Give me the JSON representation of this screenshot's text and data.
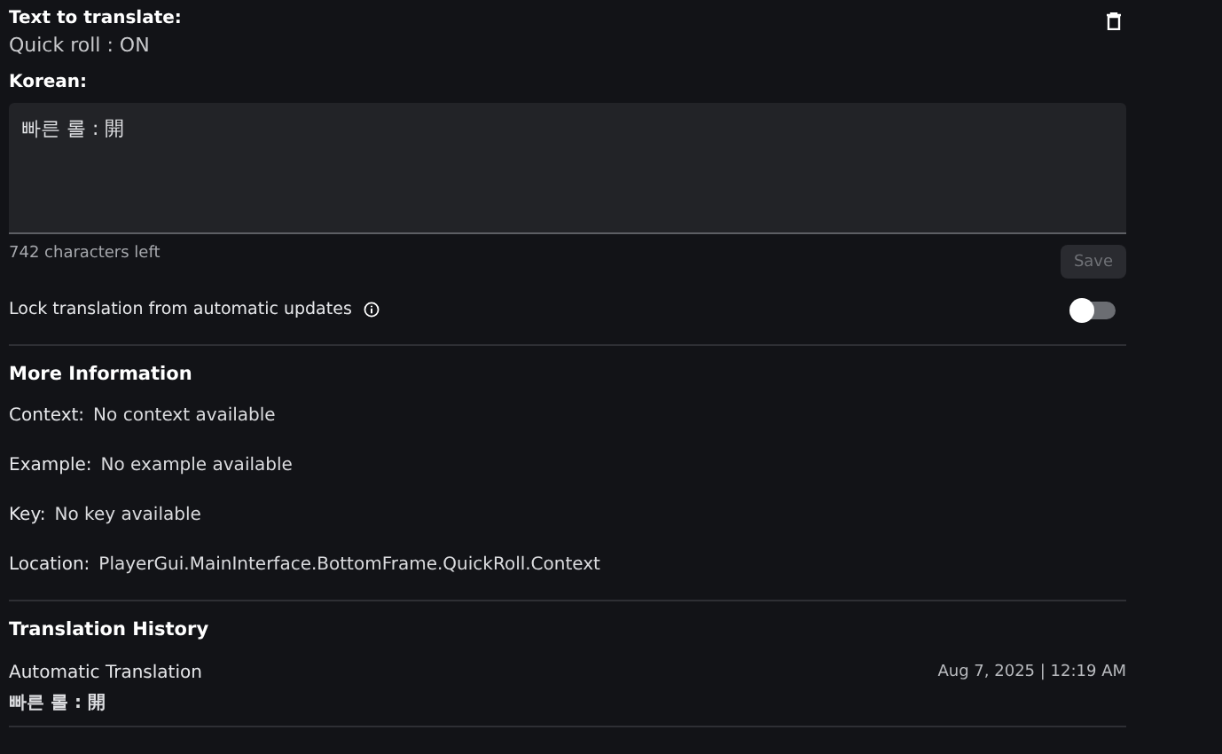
{
  "source": {
    "label": "Text to translate:",
    "text": "Quick roll : ON"
  },
  "translation": {
    "label": "Korean:",
    "value": "빠른 롤 : 開",
    "remaining": "742 characters left",
    "save_button": {
      "label": "Save",
      "disabled": true
    }
  },
  "lock": {
    "label": "Lock translation from automatic updates",
    "on": false
  },
  "more_information": {
    "title": "More Information",
    "fields": [
      {
        "label": "Context:",
        "value": "No context available"
      },
      {
        "label": "Example:",
        "value": "No example available"
      },
      {
        "label": "Key:",
        "value": "No key available"
      },
      {
        "label": "Location:",
        "value": "PlayerGui.MainInterface.BottomFrame.QuickRoll.Context"
      }
    ]
  },
  "history": {
    "title": "Translation History",
    "entries": [
      {
        "source": "Automatic Translation",
        "timestamp": "Aug 7, 2025 | 12:19 AM",
        "text": "빠른 롤 : 開"
      }
    ]
  }
}
